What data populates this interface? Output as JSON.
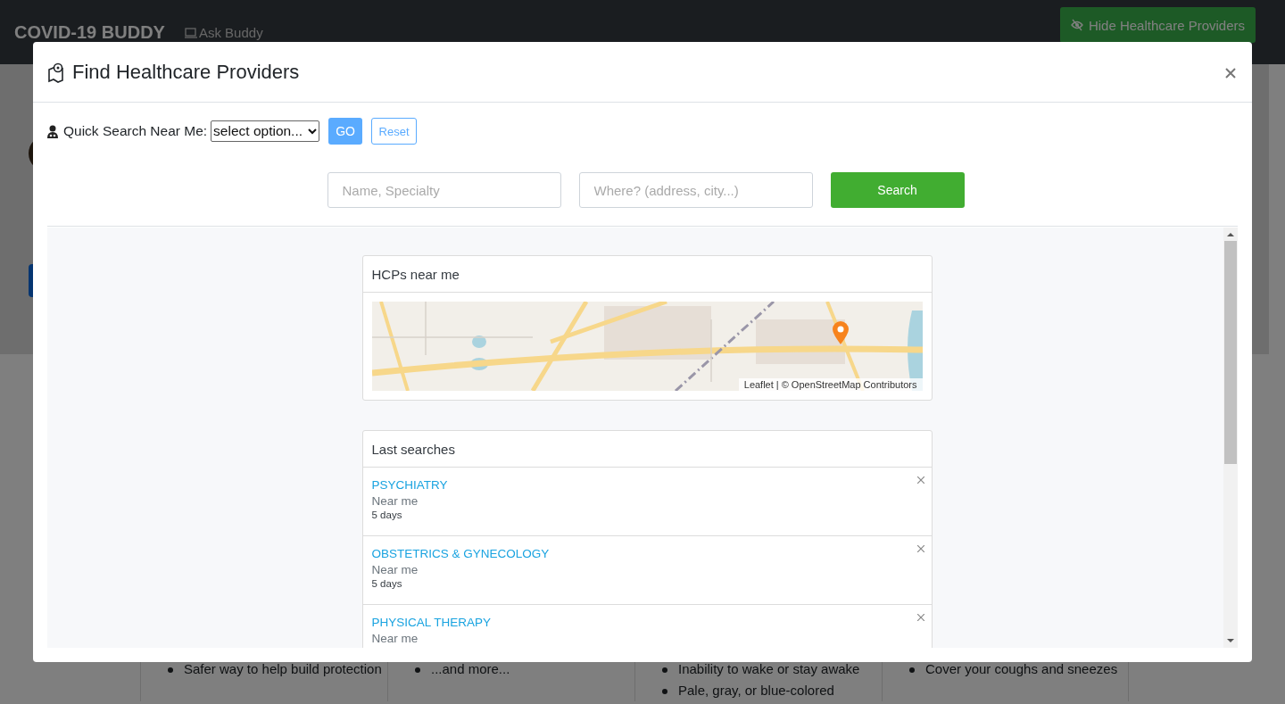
{
  "navbar": {
    "brand": "COVID-19 BUDDY",
    "link": "Ask Buddy",
    "button": "Hide Healthcare Providers"
  },
  "background": {
    "columns": [
      {
        "items": [
          "Safer way to help build protection"
        ]
      },
      {
        "items": [
          "...and more..."
        ]
      },
      {
        "items": [
          "Inability to wake or stay awake",
          "Pale, gray, or blue-colored"
        ]
      },
      {
        "items": [
          "Cover your coughs and sneezes"
        ]
      }
    ]
  },
  "modal": {
    "title": "Find Healthcare Providers",
    "quick_search": {
      "label": "Quick Search Near Me:",
      "select_value": "select option...",
      "go": "GO",
      "reset": "Reset"
    },
    "search": {
      "name_placeholder": "Name, Specialty",
      "where_placeholder": "Where? (address, city...)",
      "button": "Search"
    },
    "map_card": {
      "title": "HCPs near me",
      "attribution_link": "Leaflet",
      "attribution": "| © OpenStreetMap Contributors"
    },
    "last_searches": {
      "title": "Last searches",
      "items": [
        {
          "specialty": "PSYCHIATRY",
          "location": "Near me",
          "time": "5 days"
        },
        {
          "specialty": "OBSTETRICS & GYNECOLOGY",
          "location": "Near me",
          "time": "5 days"
        },
        {
          "specialty": "PHYSICAL THERAPY",
          "location": "Near me"
        }
      ]
    }
  }
}
